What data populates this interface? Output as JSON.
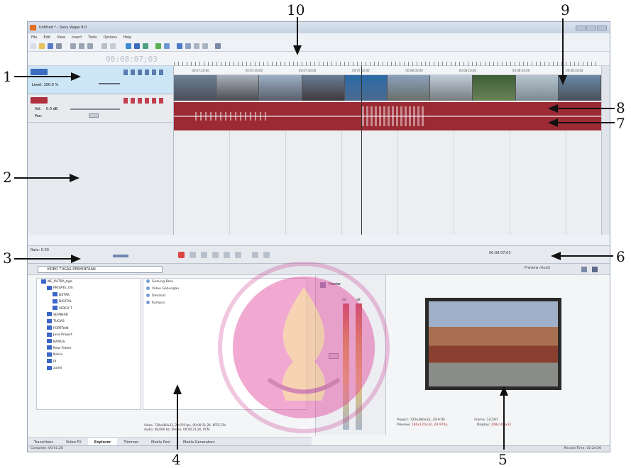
{
  "window": {
    "title": "Untitled * - Sony Vegas 8.0"
  },
  "menu": [
    "File",
    "Edit",
    "View",
    "Insert",
    "Tools",
    "Options",
    "Help"
  ],
  "timeline": {
    "counter": "00:08:07;03",
    "ruler_ticks": [
      "00:07:20;00",
      "00:07:30;00",
      "00:07:40;00",
      "00:07:50;00",
      "00:08:00;00",
      "00:08:10;00",
      "00:08:20;00",
      "00:08:30;00"
    ],
    "video_track": {
      "level": "Level: 100.0 %"
    },
    "audio_track": {
      "vol": "Vol:",
      "vol_value": "0.0 dB",
      "pan": "Pan:"
    }
  },
  "transport": {
    "rate": "Rate: 0.00",
    "time": "00:08:07;03"
  },
  "explorer": {
    "location": "VIDEO TUGAS PERMINTAAN",
    "tree": [
      "NE_PUTRA_bga",
      "PRIVATE_OS",
      "DETAK",
      "DIGITAL",
      "VIDEO T",
      "SEMINAR",
      "TUGAS",
      "FORTRAN",
      "Java Project",
      "KAMUS",
      "New Folder",
      "Nokia",
      "PI",
      "zulmi"
    ],
    "files": [
      "Gedung Baru",
      "Video Gabungan",
      "Dekanat",
      "Kampus"
    ],
    "media_info": [
      "Video: 720x480x32, 29.970 fps, 00:00:21;26, NTSC DV",
      "Audio: 48,000 Hz, Stereo, 00:00:21;26, PCM"
    ],
    "tabs": [
      "Transitions",
      "Video FX",
      "Explorer",
      "Trimmer",
      "Media Pool",
      "Media Generators"
    ],
    "selected_tab": "Explorer"
  },
  "mixer": {
    "label": "Master",
    "levels": [
      "-Inf.",
      "-Inf."
    ]
  },
  "preview": {
    "mode": "Preview (Auto)",
    "project": "Project:",
    "project_value": "720x480x32, 29.970i",
    "preview": "Preview:",
    "preview_value": "180x120x32, 29.970p",
    "frame": "Frame:",
    "frame_value": "14,597",
    "display": "Display:",
    "display_value": "248x160x32"
  },
  "status": {
    "left": "Complete: 00:01:26",
    "record": "Record Time: 10:24:50"
  },
  "callouts": [
    "1",
    "2",
    "3",
    "4",
    "5",
    "6",
    "7",
    "8",
    "9",
    "10"
  ],
  "colors": {
    "video_header": "#cde6f6",
    "audio_track": "#9c2a34",
    "watermark": "#c8328c"
  }
}
